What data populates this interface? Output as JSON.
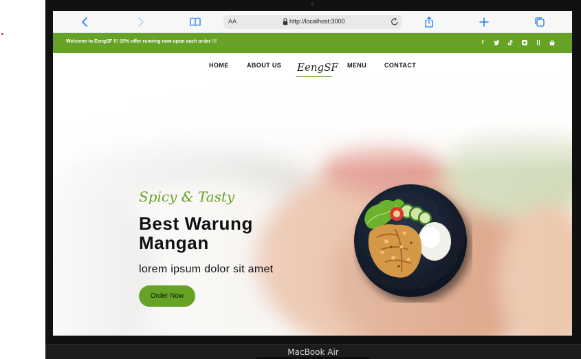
{
  "browser": {
    "reader_label": "AA",
    "url": "http://localhost:3000"
  },
  "promo_bar": {
    "text": "Welcome to EengSF !!! 15% offer running now upon each order !!!",
    "social_icons": [
      "facebook-icon",
      "twitter-icon",
      "tiktok-icon",
      "instagram-icon",
      "separator",
      "shop-icon"
    ]
  },
  "nav": {
    "home": "HOME",
    "about": "ABOUT US",
    "logo": "EengSF",
    "menu": "MENU",
    "contact": "CONTACT"
  },
  "hero": {
    "tagline": "Spicy & Tasty",
    "title": "Best Warung Mangan",
    "subtitle": "lorem ipsum dolor sit amet",
    "cta": "Order Now"
  },
  "device": {
    "label": "MacBook Air"
  },
  "colors": {
    "accent": "#65a226",
    "text": "#111111"
  }
}
